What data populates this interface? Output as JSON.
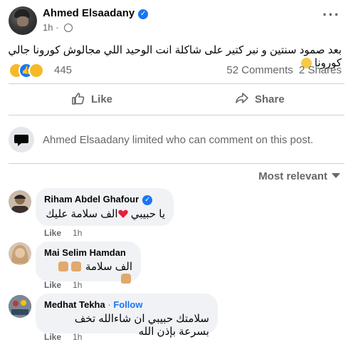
{
  "post": {
    "author": "Ahmed Elsaadany",
    "time": "1h",
    "dot": "·",
    "more_glyph": "···",
    "text": "بعد صمود سنتين و نبر كتير على شاكلة انت الوحيد اللي مجالوش كورونا جالي كورونا",
    "reaction_count": "445",
    "comments_count": "52 Comments",
    "shares_count": "2 Shares"
  },
  "actions": {
    "like_label": "Like",
    "share_label": "Share"
  },
  "notice": {
    "text": "Ahmed Elsaadany limited who can comment on this post."
  },
  "sort": {
    "label": "Most relevant"
  },
  "comments": [
    {
      "name": "Riham Abdel Ghafour",
      "text": "يا حبيبي ",
      "text2": "الف سلامة عليك",
      "like": "Like",
      "time": "1h"
    },
    {
      "name": "Mai Selim Hamdan",
      "text": "الف سلامة",
      "like": "Like",
      "time": "1h"
    },
    {
      "name": "Medhat Tekha",
      "dot": "·",
      "follow": "Follow",
      "text": "سلامتك حبيبي ان شاءالله تخف بسرعة بإذن الله",
      "like": "Like",
      "time": "1h"
    }
  ],
  "colors": {
    "accent": "#1877f2",
    "secondary_text": "#65676b",
    "bubble_bg": "#f0f2f5",
    "divider": "#ced0d4",
    "heart": "#e41e3f"
  }
}
